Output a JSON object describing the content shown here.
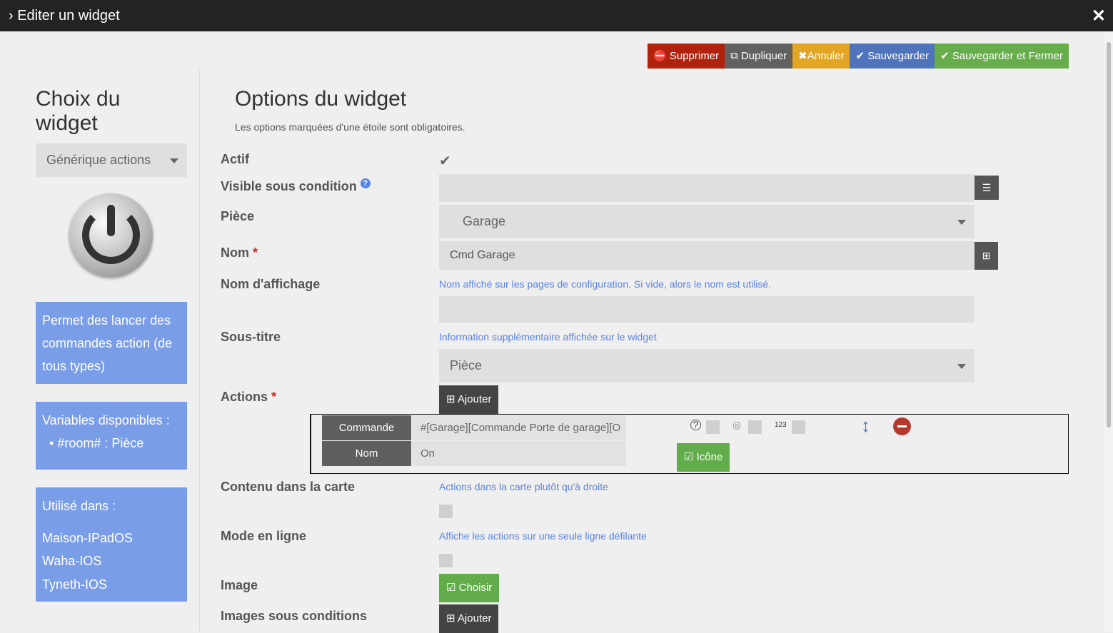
{
  "title": "Editer un widget",
  "toolbar": {
    "delete": "Supprimer",
    "duplicate": "Dupliquer",
    "cancel": "Annuler",
    "save": "Sauvegarder",
    "save_close": "Sauvegarder et Fermer"
  },
  "left": {
    "title": "Choix du widget",
    "widget_type": "Générique actions",
    "description": "Permet des lancer des commandes action (de tous types)",
    "variables_title": "Variables disponibles :",
    "variables": [
      "#room# : Pièce"
    ],
    "used_title": "Utilisé dans :",
    "used_in": [
      "Maison-IPadOS",
      "Waha-IOS",
      "Tyneth-IOS"
    ]
  },
  "main": {
    "title": "Options du widget",
    "subtitle": "Les options marquées d'une étoile sont obligatoires.",
    "labels": {
      "actif": "Actif",
      "visible": "Visible sous condition",
      "piece": "Pièce",
      "nom": "Nom",
      "nom_affichage": "Nom d'affichage",
      "sous_titre": "Sous-titre",
      "actions": "Actions",
      "contenu": "Contenu dans la carte",
      "mode": "Mode en ligne",
      "image": "Image",
      "images_cond": "Images sous conditions"
    },
    "required": "*",
    "piece_value": "Garage",
    "nom_value": "Cmd Garage",
    "hint_nom_affichage": "Nom affiché sur les pages de configuration. Si vide, alors le nom est utilisé.",
    "hint_sous_titre": "Information supplémentaire affichée sur le widget",
    "sous_titre_value": "Pièce",
    "add": "Ajouter",
    "choose": "Choisir",
    "hint_contenu": "Actions dans la carte plutôt qu'à droite",
    "hint_mode": "Affiche les actions sur une seule ligne défilante",
    "action": {
      "cmd_label": "Commande",
      "cmd_value": "#[Garage][Commande Porte de garage][O",
      "name_label": "Nom",
      "name_value": "On",
      "num_icon": "123",
      "icon_btn": "Icône"
    }
  },
  "colors": {
    "delete": "#b0220e",
    "duplicate": "#616161",
    "cancel": "#e3a624",
    "save": "#4f74bb",
    "save_close": "#67ad4c",
    "box": "#7a9de8"
  }
}
